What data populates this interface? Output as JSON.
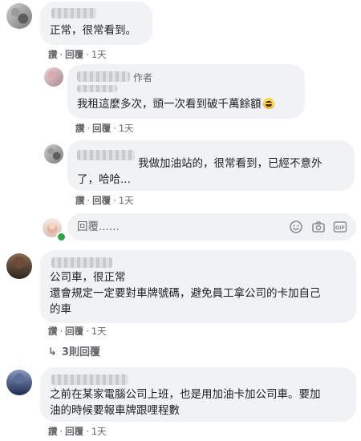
{
  "actions": {
    "like": "讚",
    "reply": "回覆",
    "sep": "·"
  },
  "comments": [
    {
      "text_lines": [
        "正常，很常看到。"
      ],
      "time": "1天"
    },
    {
      "author_badge": "作者",
      "text_lines": [
        "我租這麼多次，頭一次看到破千萬餘額"
      ],
      "emoji": "grinning-face",
      "time": "1天"
    },
    {
      "text_lines": [
        "我做加油站的，很常看到，已經不意外",
        "了，哈哈..."
      ],
      "time": "1天"
    },
    {
      "text_lines": [
        "公司車，很正常",
        "還會規定一定要對車牌號碼，避免員工拿公司的卡加自己",
        "的車"
      ],
      "time": "1天",
      "more_replies": "3則回覆"
    },
    {
      "text_lines": [
        "之前在某家電腦公司上班，也是用加油卡加公司車。要加",
        "油的時候要報車牌跟哩程數"
      ],
      "time": "1天"
    }
  ],
  "reply_box": {
    "placeholder": "回覆......",
    "icons": [
      "smiley-icon",
      "camera-icon",
      "gif-icon",
      "sticker-icon"
    ]
  },
  "colors": {
    "bubble": "#f0f2f5",
    "meta_text": "#65676b",
    "online": "#31a24c"
  }
}
